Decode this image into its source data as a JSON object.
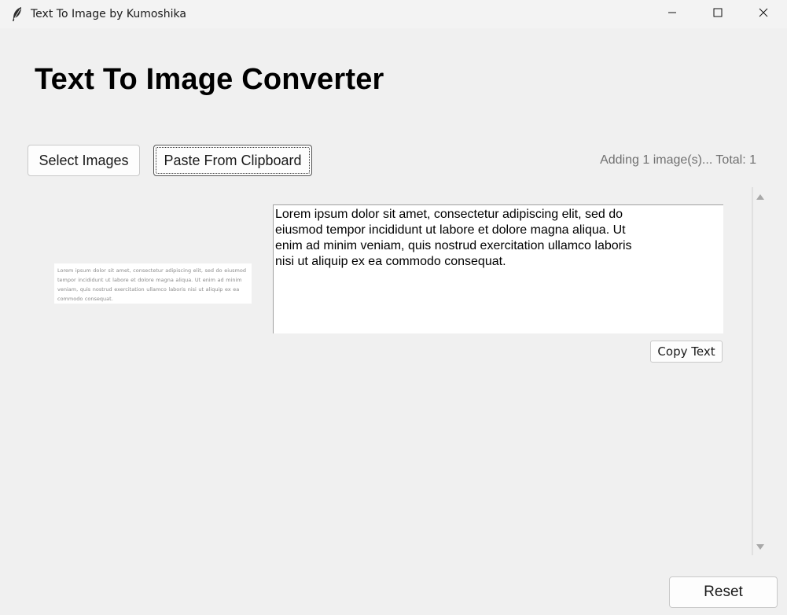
{
  "window": {
    "title": "Text To Image by Kumoshika",
    "controls": [
      "minimize-icon",
      "maximize-icon",
      "close-icon"
    ]
  },
  "header": {
    "title": "Text To Image Converter"
  },
  "toolbar": {
    "select_images_label": "Select Images",
    "paste_clipboard_label": "Paste From Clipboard",
    "status_text": "Adding 1 image(s)... Total: 1"
  },
  "entries": [
    {
      "thumbnail_text": "Lorem ipsum dolor sit amet, consectetur adipiscing elit, sed do eiusmod tempor incididunt ut labore et dolore magna aliqua. Ut enim ad minim veniam, quis nostrud exercitation ullamco laboris nisi ut aliquip ex ea commodo consequat.",
      "extracted_text": "Lorem ipsum dolor sit amet, consectetur adipiscing elit, sed do\neiusmod tempor incididunt ut labore et dolore magna aliqua. Ut\nenim ad minim veniam, quis nostrud exercitation ullamco laboris\nnisi ut aliquip ex ea commodo consequat.",
      "copy_label": "Copy Text"
    }
  ],
  "footer": {
    "reset_label": "Reset"
  },
  "icons": {
    "app": "feather-icon",
    "scroll_up": "triangle-up-icon",
    "scroll_down": "triangle-down-icon"
  },
  "colors": {
    "background": "#f0f0f0",
    "status_text": "#707070"
  }
}
